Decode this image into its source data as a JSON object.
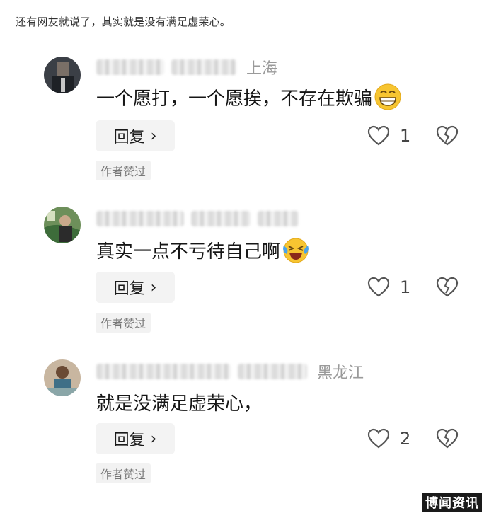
{
  "intro_text": "还有网友就说了，其实就是没有满足虚荣心。",
  "comments": [
    {
      "location": "上海",
      "text": "一个愿打，一个愿挨，不存在欺骗",
      "emoji": "grin-emoji",
      "reply_label": "回复",
      "likes": "1",
      "author_tag": "作者赞过"
    },
    {
      "location": "",
      "text": "真实一点不亏待自己啊",
      "emoji": "laughing-crying-emoji",
      "reply_label": "回复",
      "likes": "1",
      "author_tag": "作者赞过"
    },
    {
      "location": "黑龙江",
      "text": "就是没满足虚荣心，",
      "emoji": "",
      "reply_label": "回复",
      "likes": "2",
      "author_tag": "作者赞过"
    }
  ],
  "icons": {
    "like": "heart-outline-icon",
    "dislike": "broken-heart-icon",
    "reply_chevron": "chevron-right-icon"
  },
  "watermark": "博闻资讯",
  "colors": {
    "background": "#ffffff",
    "button_bg": "#f3f3f3",
    "tag_bg": "#f2f2f2",
    "muted_text": "#9a9a9a"
  }
}
